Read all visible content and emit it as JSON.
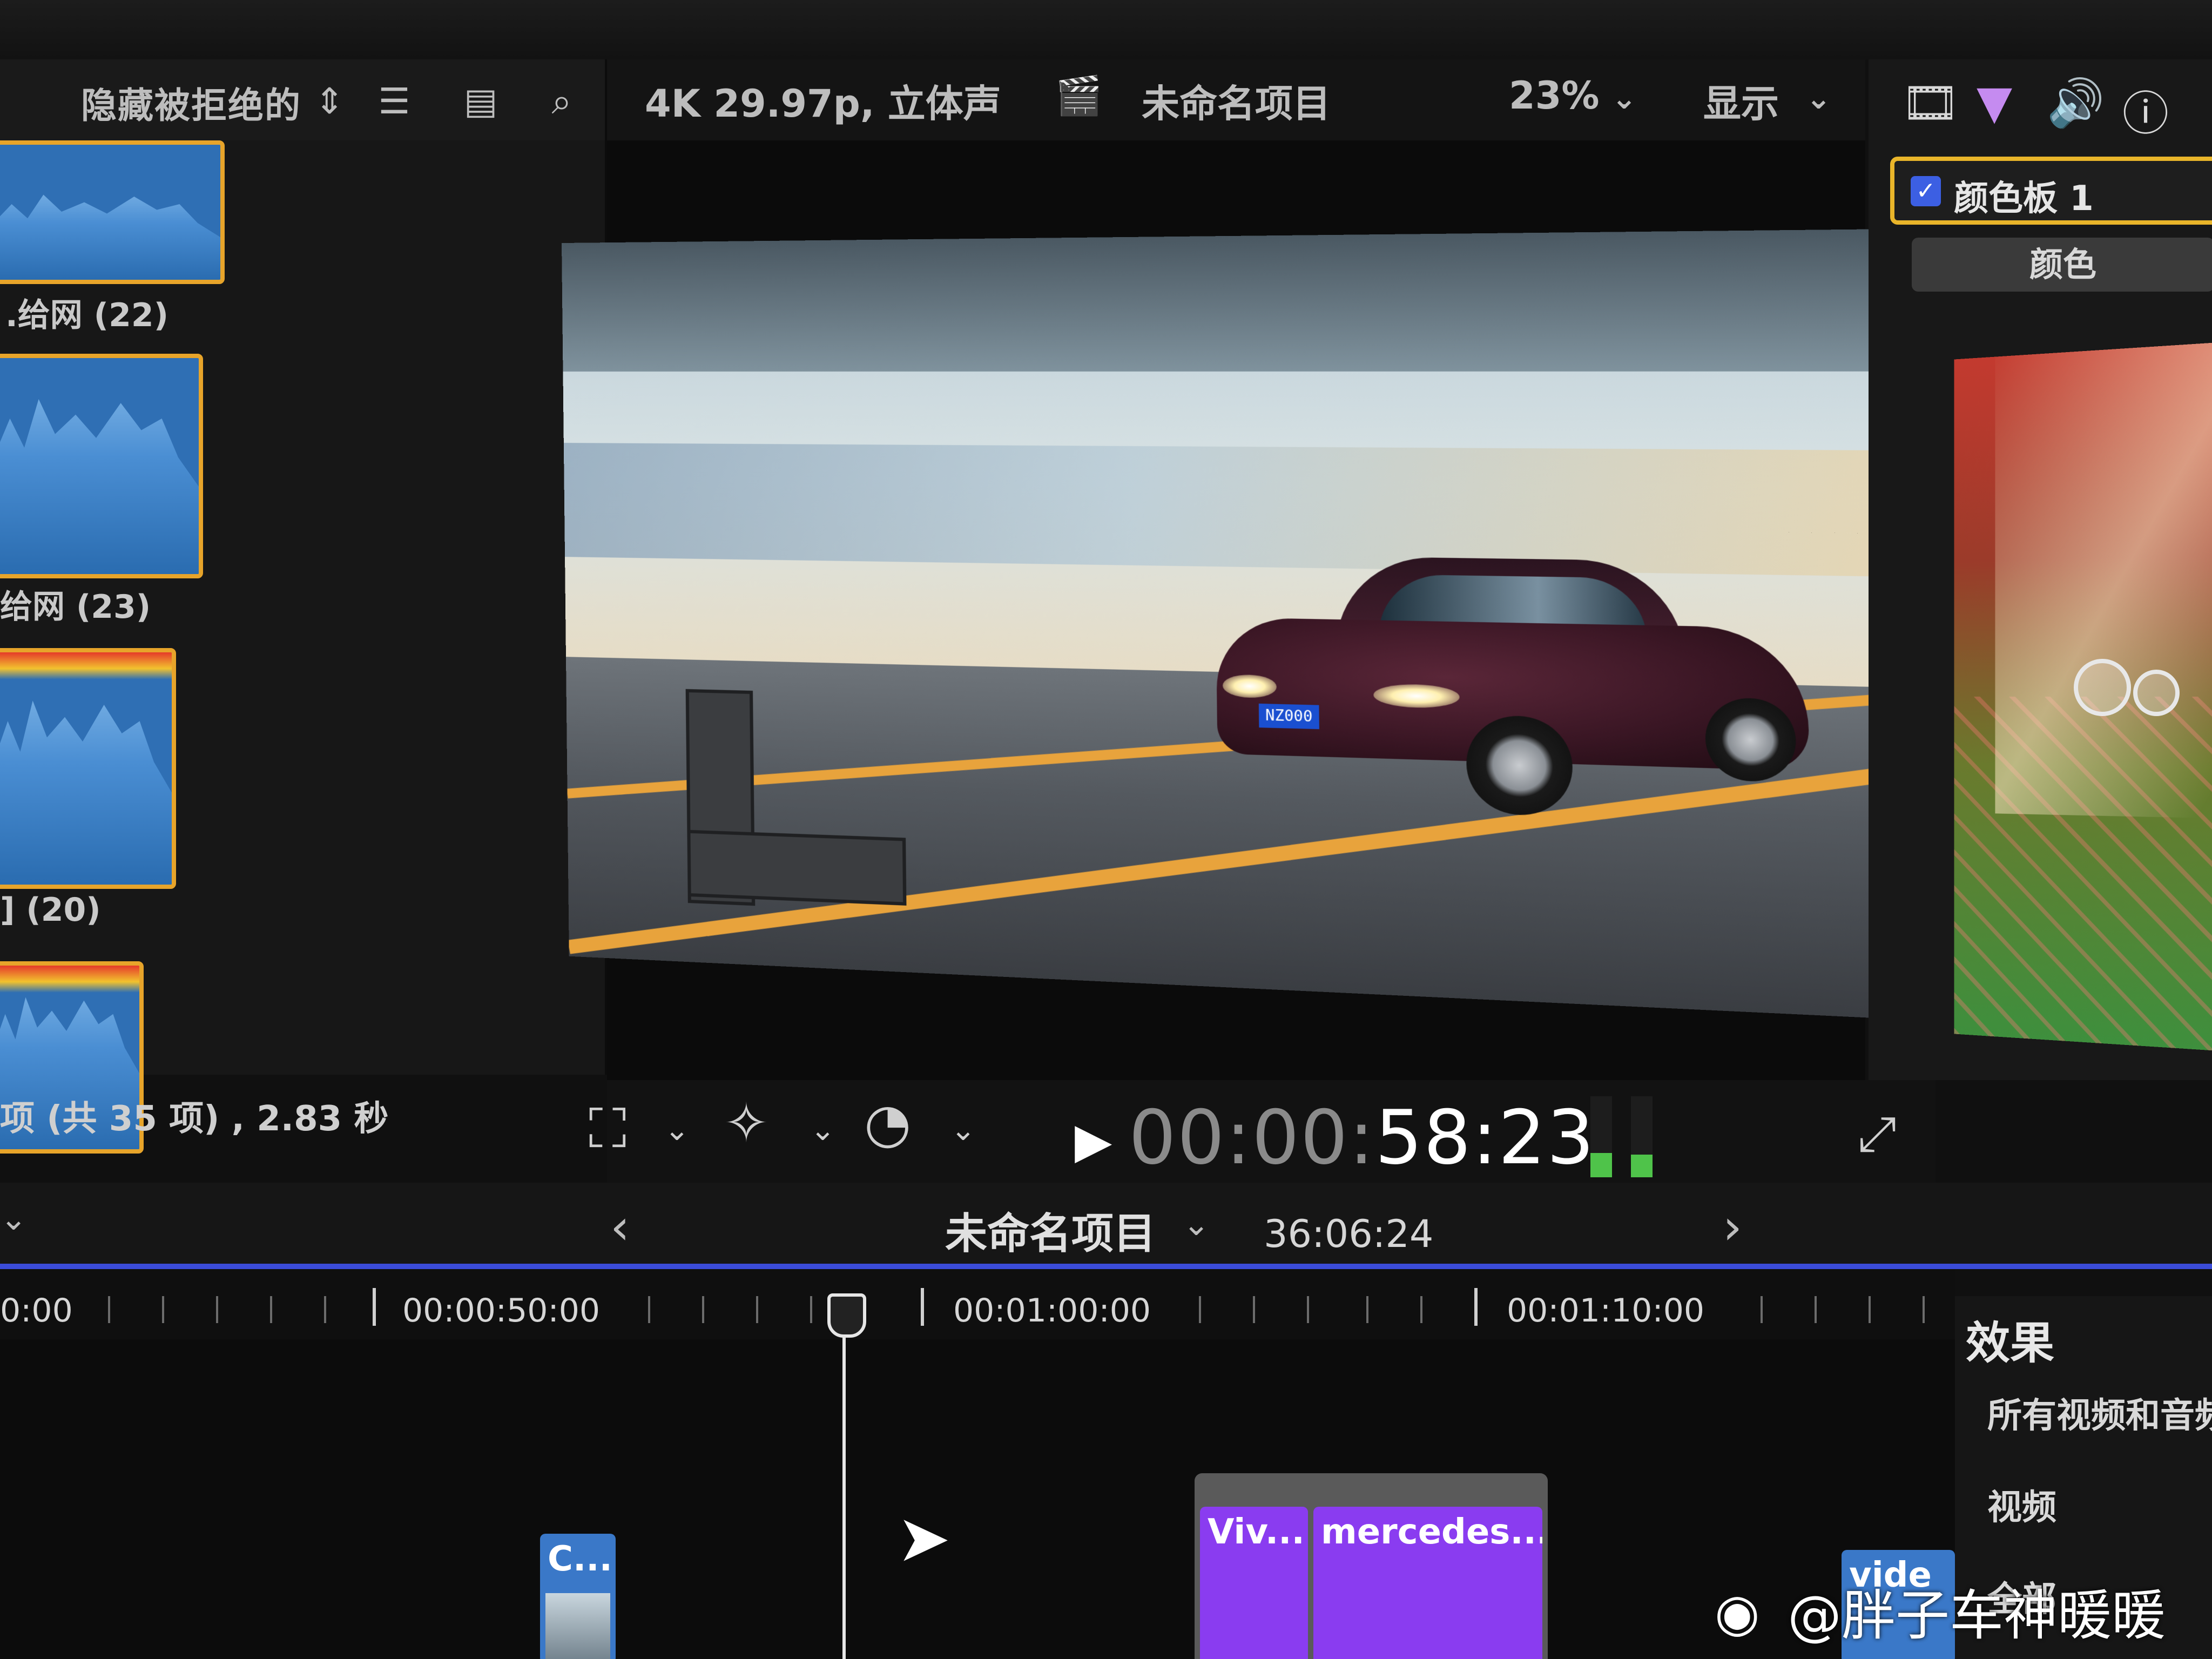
{
  "browser": {
    "filter_label": "隐藏被拒绝的",
    "clips": [
      {
        "label": ".给网 (22)"
      },
      {
        "label": "给网 (23)"
      },
      {
        "label": "] (20)"
      }
    ],
    "status": "项 (共 35 项) , 2.83 秒"
  },
  "viewer": {
    "format": "4K 29.97p, 立体声",
    "project": "未命名项目",
    "zoom": "23%",
    "view_menu": "显示",
    "timecode_dim": "00:00:",
    "timecode_main": "58:23"
  },
  "inspector": {
    "board_label": "颜色板 1",
    "tab_label": "颜色"
  },
  "timeline": {
    "start_partial": "0:00",
    "project": "未命名项目",
    "duration": "36:06:24",
    "ruler": [
      "00:00:50:00",
      "00:01:00:00",
      "00:01:10:00"
    ],
    "clips": [
      {
        "label": "C..."
      },
      {
        "label": "Viv..."
      },
      {
        "label": "mercedes..."
      },
      {
        "label": "vide"
      }
    ]
  },
  "effects": {
    "title": "效果",
    "rows": [
      "所有视频和音频",
      "视频",
      "全部"
    ]
  },
  "watermark": {
    "text": "@胖子车神暖暖"
  },
  "colors": {
    "accent_blue": "#3b4cd8",
    "clip_purple": "#8a3cf0",
    "selection_yellow": "#e9b52a"
  }
}
